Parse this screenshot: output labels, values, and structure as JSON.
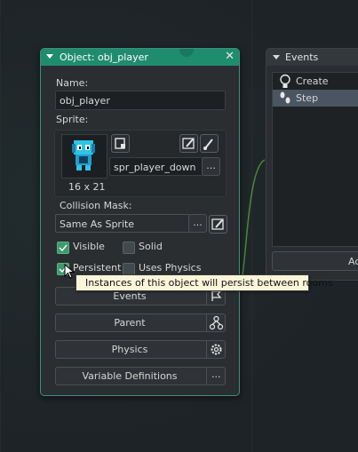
{
  "object_panel": {
    "title": "Object: obj_player",
    "name_label": "Name:",
    "name_value": "obj_player",
    "sprite_label": "Sprite:",
    "sprite_value": "spr_player_down",
    "sprite_size": "16 x 21",
    "collision_mask_label": "Collision Mask:",
    "collision_mask_value": "Same As Sprite",
    "checkboxes": [
      {
        "label": "Visible",
        "checked": true
      },
      {
        "label": "Solid",
        "checked": false
      },
      {
        "label": "Persistent",
        "checked": true
      },
      {
        "label": "Uses Physics",
        "checked": false
      }
    ],
    "buttons": {
      "events": "Events",
      "parent": "Parent",
      "physics": "Physics",
      "variable_definitions": "Variable Definitions"
    },
    "ellipsis": "..."
  },
  "events_panel": {
    "title": "Events",
    "items": [
      "Create",
      "Step"
    ],
    "add_button_partial": "Ac"
  },
  "tooltip": {
    "text": "Instances of this object will persist between rooms"
  },
  "colors": {
    "accent": "#1f8c6e",
    "checkbox_on": "#3e9a6a",
    "selected_row": "#4a5561"
  }
}
